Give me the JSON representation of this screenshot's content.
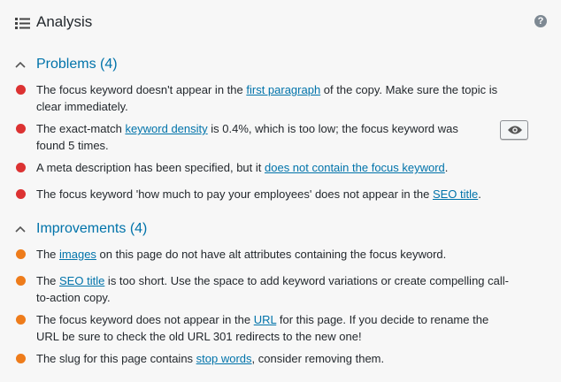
{
  "header": {
    "title": "Analysis",
    "help_symbol": "?"
  },
  "problems": {
    "heading": "Problems (4)",
    "items": [
      {
        "before": "The focus keyword doesn't appear in the ",
        "link": "first paragraph",
        "after": " of the copy. Make sure the topic is clear immediately."
      },
      {
        "before": "The exact-match ",
        "link": "keyword density",
        "after": " is 0.4%, which is too low; the focus keyword was found 5 times."
      },
      {
        "before": "A meta description has been specified, but it ",
        "link": "does not contain the focus keyword",
        "after": "."
      },
      {
        "before": "The focus keyword 'how much to pay your employees' does not appear in the ",
        "link": "SEO title",
        "after": "."
      }
    ]
  },
  "improvements": {
    "heading": "Improvements (4)",
    "items": [
      {
        "before": "The ",
        "link": "images",
        "after": " on this page do not have alt attributes containing the focus keyword."
      },
      {
        "before": "The ",
        "link": "SEO title",
        "after": " is too short. Use the space to add keyword variations or create compelling call-to-action copy."
      },
      {
        "before": "The focus keyword does not appear in the ",
        "link": "URL",
        "after": " for this page. If you decide to rename the URL be sure to check the old URL 301 redirects to the new one!"
      },
      {
        "before": "The slug for this page contains ",
        "link": "stop words",
        "after": ", consider removing them."
      }
    ]
  },
  "colors": {
    "problem": "#dc3232",
    "improvement": "#ee7c1b",
    "link": "#0073aa"
  },
  "icons": {
    "header": "list-icon",
    "help": "help-icon",
    "collapse": "chevron-up-icon",
    "highlight": "eye-icon"
  }
}
